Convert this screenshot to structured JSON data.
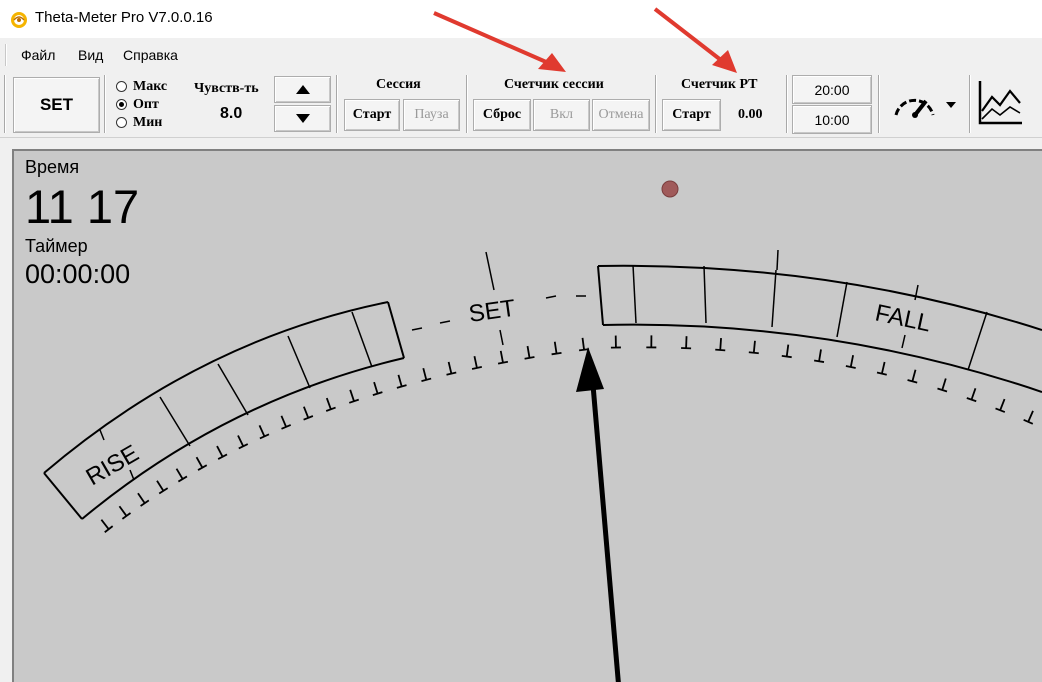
{
  "window": {
    "title": "Theta-Meter Pro V7.0.0.16"
  },
  "menu": {
    "items": [
      "Файл",
      "Вид",
      "Справка"
    ]
  },
  "toolbar": {
    "set_button": "SET",
    "sensitivity": {
      "options": [
        "Макс",
        "Опт",
        "Мин"
      ],
      "selected": "Опт",
      "label": "Чувств-ть",
      "value": "8.0"
    },
    "session": {
      "label": "Сессия",
      "start": "Старт",
      "pause": "Пауза"
    },
    "session_counter": {
      "label": "Счетчик сессии",
      "reset": "Сброс",
      "on": "Вкл",
      "cancel": "Отмена"
    },
    "pt_counter": {
      "label": "Счетчик РТ",
      "start": "Старт",
      "value": "0.00"
    },
    "time_buttons": [
      "20:00",
      "10:00"
    ],
    "icons": {
      "gauge": "gauge-icon",
      "dropdown": "chevron-down-icon",
      "chart": "line-chart-icon",
      "up": "arrow-up-icon",
      "down": "arrow-down-icon"
    }
  },
  "meter": {
    "time_label": "Время",
    "time_value": "11 17",
    "timer_label": "Таймер",
    "timer_value": "00:00:00",
    "dial_labels": {
      "rise": "RISE",
      "set": "SET",
      "fall": "FALL"
    },
    "indicator_color": "#a05a5a",
    "background_color": "#c9c9c9"
  },
  "annotations": {
    "arrow_color": "#e03a2f"
  }
}
